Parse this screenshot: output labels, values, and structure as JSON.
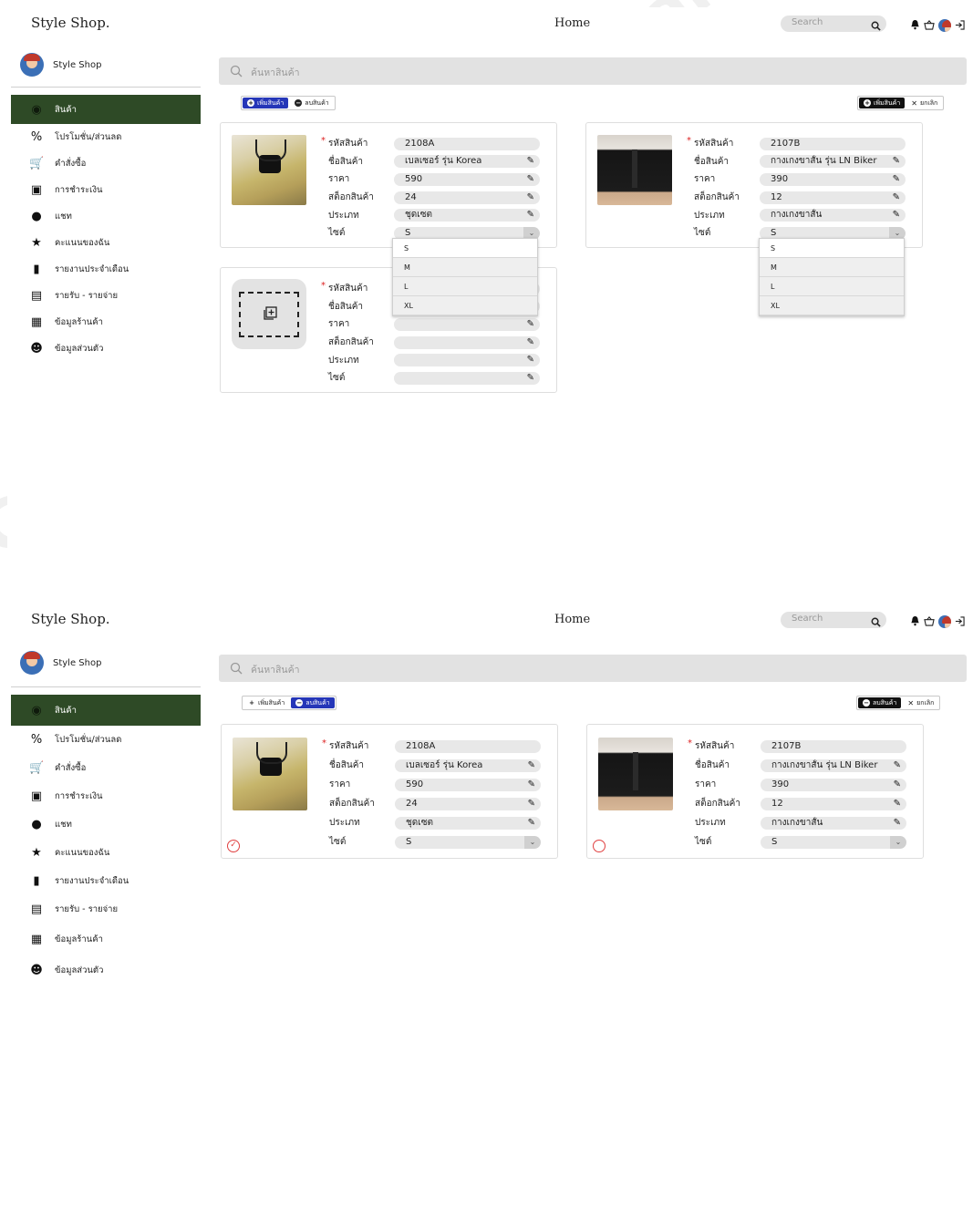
{
  "brand": "Style Shop.",
  "nav_home": "Home",
  "top_search_placeholder": "Search",
  "profile_name": "Style Shop",
  "sidebar": {
    "items": [
      {
        "label": "สินค้า",
        "icon": "box-icon"
      },
      {
        "label": "โปรโมชั่น/ส่วนลด",
        "icon": "percent-icon"
      },
      {
        "label": "คำสั่งซื้อ",
        "icon": "cart-icon"
      },
      {
        "label": "การชำระเงิน",
        "icon": "payment-icon"
      },
      {
        "label": "แชท",
        "icon": "chat-icon"
      },
      {
        "label": "คะแนนของฉัน",
        "icon": "star-icon"
      },
      {
        "label": "รายงานประจำเดือน",
        "icon": "bar-chart-icon"
      },
      {
        "label": "รายรับ - รายจ่าย",
        "icon": "clipboard-icon"
      },
      {
        "label": "ข้อมูลร้านค้า",
        "icon": "store-icon"
      },
      {
        "label": "ข้อมูลส่วนตัว",
        "icon": "user-settings-icon"
      }
    ]
  },
  "product_search_placeholder": "ค้นหาสินค้า",
  "mode_toggle": {
    "add_label": "เพิ่มสินค้า",
    "delete_label": "ลบสินค้า"
  },
  "action_toggle": {
    "add_label": "เพิ่มสินค้า",
    "delete_label": "ลบสินค้า",
    "cancel_label": "ยกเลิก"
  },
  "field_labels": {
    "code": "รหัสสินค้า",
    "name": "ชื่อสินค้า",
    "price": "ราคา",
    "stock": "สต็อกสินค้า",
    "category": "ประเภท",
    "size": "ไซต์"
  },
  "products": [
    {
      "code": "2108A",
      "name": "เบลเซอร์ รุ่น Korea",
      "price": "590",
      "stock": "24",
      "category": "ชุดเซต",
      "size": "S",
      "category_short": "ชุดเซต"
    },
    {
      "code": "2107B",
      "name": "กางเกงขาสั้น รุ่น LN Biker",
      "price": "390",
      "stock": "12",
      "category": "กางเกงขาสั้น",
      "size": "S",
      "category_short": "กางเกงขาสั้น"
    }
  ],
  "size_options": [
    "S",
    "M",
    "L",
    "XL"
  ],
  "watermark": "Computer Science Department, Faculty of Informatics, Mahasarakham University",
  "colors": {
    "sidebar_active": "#2e4a26",
    "accent_blue": "#2536b8",
    "required": "#dd2222"
  }
}
